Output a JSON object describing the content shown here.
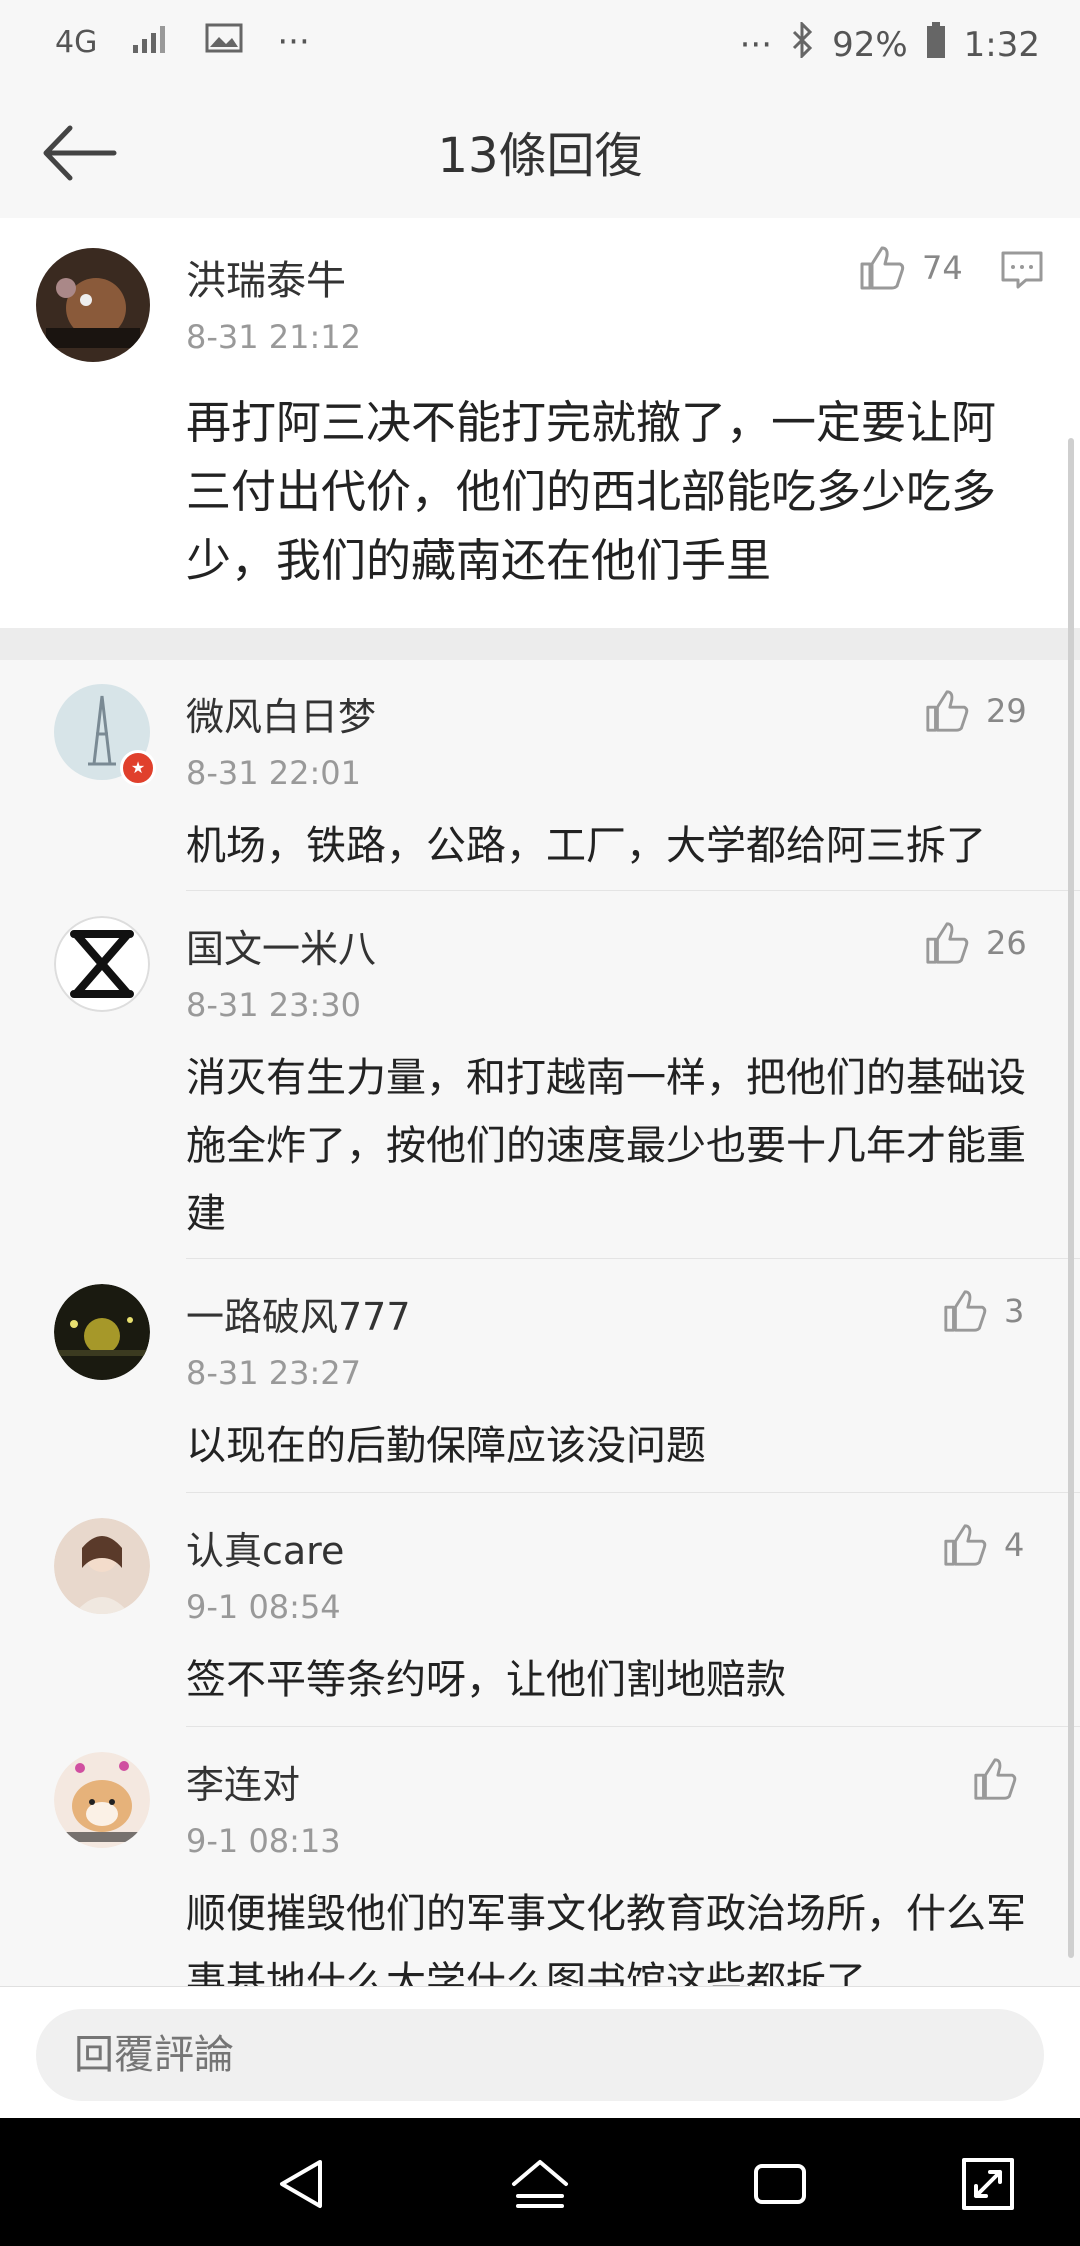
{
  "status_bar": {
    "network": "4G",
    "more_left": "···",
    "more_right": "···",
    "battery": "92%",
    "time": "1:32"
  },
  "header": {
    "title": "13條回復"
  },
  "original_comment": {
    "user": "洪瑞泰牛",
    "time": "8-31 21:12",
    "likes": "74",
    "text": "再打阿三决不能打完就撤了，一定要让阿三付出代价，他们的西北部能吃多少吃多少，我们的藏南还在他们手里"
  },
  "replies": [
    {
      "user": "微风白日梦",
      "time": "8-31 22:01",
      "likes": "29",
      "text": "机场，铁路，公路，工厂，大学都给阿三拆了"
    },
    {
      "user": "国文一米八",
      "time": "8-31 23:30",
      "likes": "26",
      "text": "消灭有生力量，和打越南一样，把他们的基础设施全炸了，按他们的速度最少也要十几年才能重建"
    },
    {
      "user": "一路破风777",
      "time": "8-31 23:27",
      "likes": "3",
      "text": "以现在的后勤保障应该没问题"
    },
    {
      "user": "认真care",
      "time": "9-1 08:54",
      "likes": "4",
      "text": "签不平等条约呀，让他们割地赔款"
    },
    {
      "user": "李连对",
      "time": "9-1 08:13",
      "likes": "",
      "text": "顺便摧毁他们的军事文化教育政治场所，什么军事基地什么大学什么图书馆这些都拆了"
    }
  ],
  "reply_bar": {
    "placeholder": "回覆評論"
  },
  "colors": {
    "background": "#f7f7f7",
    "card": "#ffffff",
    "badge": "#e0402c",
    "navbar": "#000000"
  }
}
